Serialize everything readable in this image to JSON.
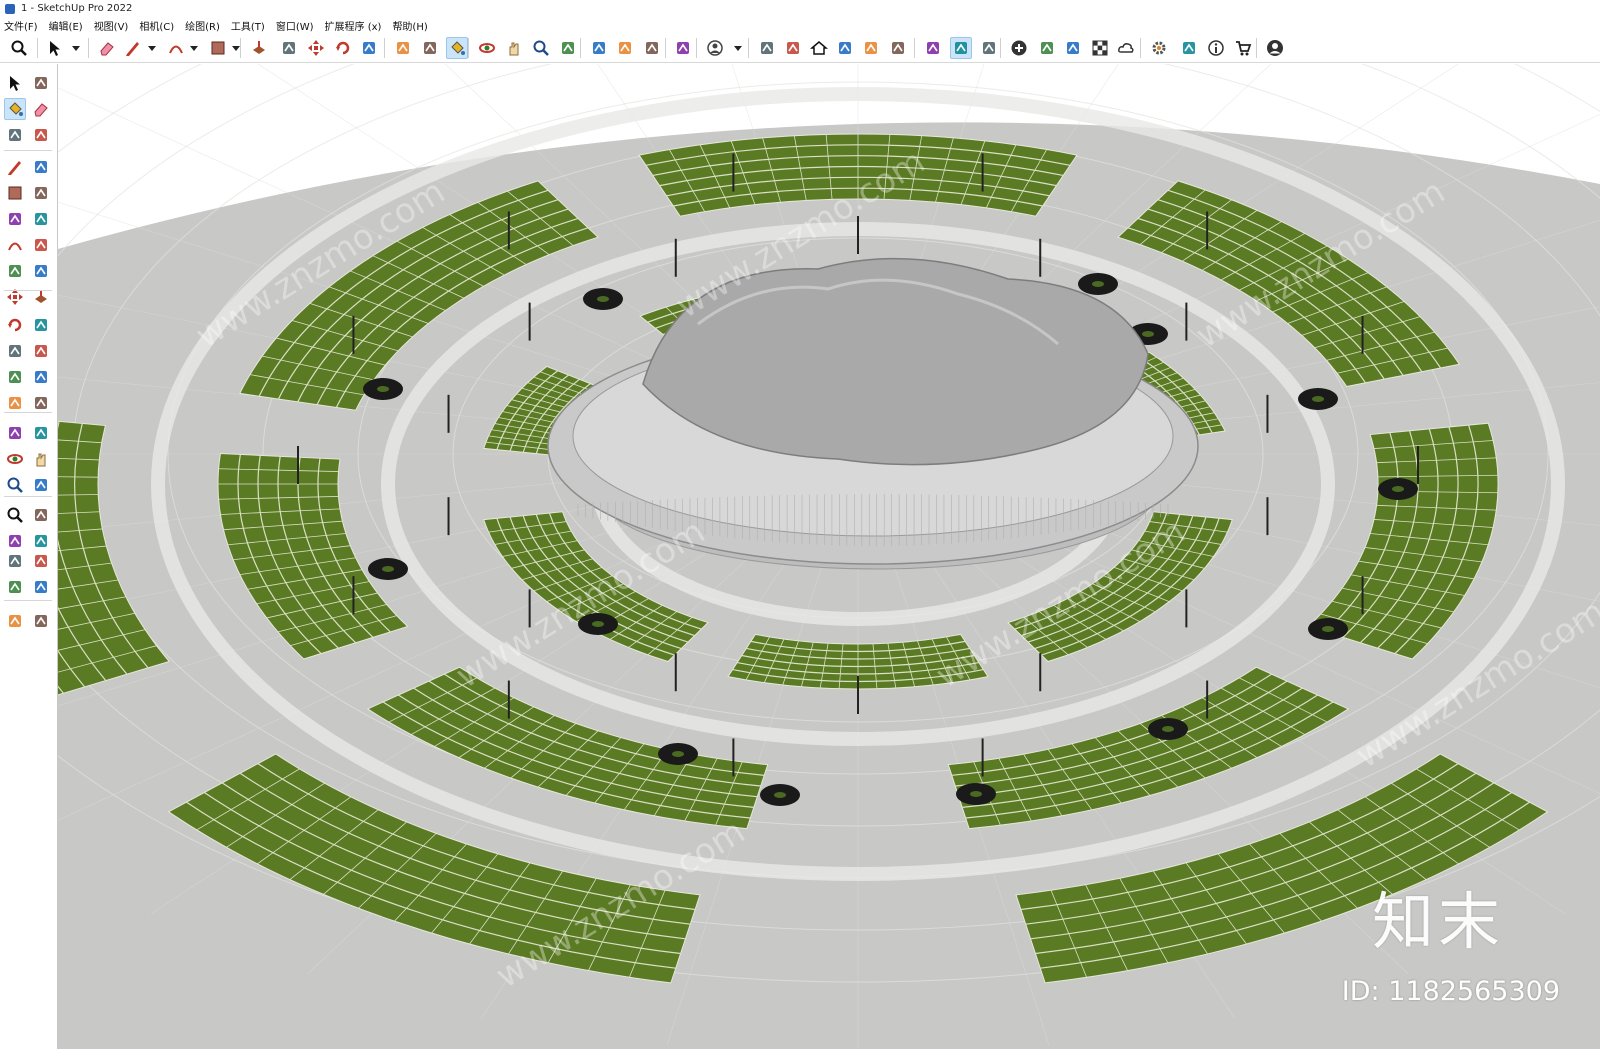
{
  "window": {
    "title": "1 - SketchUp Pro 2022"
  },
  "menubar": {
    "items": [
      "文件(F)",
      "编辑(E)",
      "视图(V)",
      "相机(C)",
      "绘图(R)",
      "工具(T)",
      "窗口(W)",
      "扩展程序 (x)",
      "帮助(H)"
    ]
  },
  "toolbar": {
    "tools": [
      "zoom-extents-icon",
      "select-icon",
      "eraser-icon",
      "pencil-line-icon",
      "arc-icon",
      "rectangle-icon",
      "push-pull-icon",
      "follow-me-icon",
      "move-icon",
      "rotate-icon",
      "scale-icon",
      "tape-measure-icon",
      "text-icon",
      "paint-bucket-icon",
      "orbit-icon",
      "pan-icon",
      "zoom-icon",
      "zoom-window-icon",
      "warehouse-icon",
      "extension-icon",
      "layers-icon",
      "sandbox-icon",
      "user-icon",
      "iso-view-icon",
      "front-view-icon",
      "home-view-icon",
      "right-view-icon",
      "back-view-icon",
      "left-view-icon",
      "style-icon",
      "section-icon",
      "scene-icon",
      "add-location-icon",
      "shield-icon",
      "report-icon",
      "checker-icon",
      "cloud-icon",
      "settings-icon",
      "window-icon",
      "info-icon",
      "cart-icon",
      "account-icon"
    ],
    "active": [
      "paint-bucket-icon",
      "section-icon"
    ]
  },
  "left_toolbar": {
    "tools": [
      "select-icon",
      "orbit-small-icon",
      "paint-bucket-icon",
      "eraser-icon",
      "component-icon",
      "tag-icon",
      "line-icon",
      "freehand-icon",
      "rectangle-icon",
      "rotated-rectangle-icon",
      "circle-icon",
      "polygon-icon",
      "arc-icon",
      "two-point-arc-icon",
      "three-point-arc-icon",
      "pie-icon",
      "move-icon",
      "push-pull-icon",
      "rotate-icon",
      "follow-me-icon",
      "scale-icon",
      "offset-icon",
      "tape-measure-icon",
      "dimension-icon",
      "protractor-icon",
      "text-icon",
      "axes-icon",
      "3d-text-icon",
      "orbit-icon",
      "pan-icon",
      "zoom-icon",
      "zoom-window-icon",
      "zoom-extents-icon",
      "previous-view-icon",
      "position-camera-icon",
      "look-around-icon",
      "walk-icon",
      "section-plane-icon",
      "warehouse-icon",
      "extension-warehouse-icon",
      "layout-icon",
      "sandbox-icon"
    ],
    "active": [
      "paint-bucket-icon"
    ]
  },
  "viewport": {
    "watermark_text": "www.znzmo.com",
    "watermark_logo": "知末",
    "watermark_id": "ID: 1182565309",
    "colors": {
      "ground": "#c8c8c6",
      "sky": "#ffffff",
      "grass": "#5b7a24",
      "stadium": "#c9c9c9",
      "tree_dot": "#1a1a1a"
    }
  }
}
